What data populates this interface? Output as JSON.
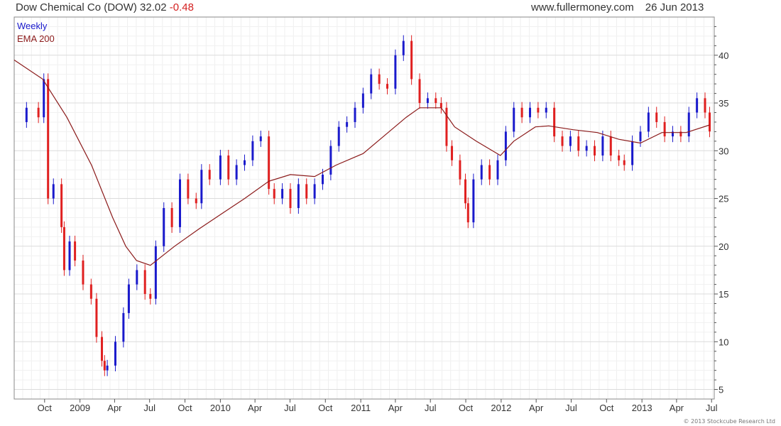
{
  "header": {
    "security": "Dow Chemical Co (DOW)",
    "last": "32.02",
    "change": "-0.48",
    "site": "www.fullermoney.com",
    "date": "26 Jun 2013"
  },
  "footer": {
    "copyright": "© 2013 Stockcube Research Ltd"
  },
  "colors": {
    "up": "#1a1acc",
    "down": "#e02020",
    "ema": "#8b1a1a",
    "grid": "#dcdcdc",
    "axis": "#555555"
  },
  "chart_data": {
    "type": "line",
    "legend": [
      "Weekly",
      "EMA 200"
    ],
    "legend_position": "top-left",
    "grid": true,
    "ylim": [
      4,
      44
    ],
    "y_ticks": [
      5,
      10,
      15,
      20,
      25,
      30,
      35,
      40
    ],
    "x_range": [
      "2008-07-14",
      "2013-07-08"
    ],
    "x_ticks": [
      {
        "label": "Oct",
        "date": "2008-10-01"
      },
      {
        "label": "2009",
        "date": "2009-01-01"
      },
      {
        "label": "Apr",
        "date": "2009-04-01"
      },
      {
        "label": "Jul",
        "date": "2009-07-01"
      },
      {
        "label": "Oct",
        "date": "2009-10-01"
      },
      {
        "label": "2010",
        "date": "2010-01-01"
      },
      {
        "label": "Apr",
        "date": "2010-04-01"
      },
      {
        "label": "Jul",
        "date": "2010-07-01"
      },
      {
        "label": "Oct",
        "date": "2010-10-01"
      },
      {
        "label": "2011",
        "date": "2011-01-01"
      },
      {
        "label": "Apr",
        "date": "2011-04-01"
      },
      {
        "label": "Jul",
        "date": "2011-07-01"
      },
      {
        "label": "Oct",
        "date": "2011-10-01"
      },
      {
        "label": "2012",
        "date": "2012-01-01"
      },
      {
        "label": "Apr",
        "date": "2012-04-01"
      },
      {
        "label": "Jul",
        "date": "2012-07-01"
      },
      {
        "label": "Oct",
        "date": "2012-10-01"
      },
      {
        "label": "2013",
        "date": "2013-01-01"
      },
      {
        "label": "Apr",
        "date": "2013-04-01"
      },
      {
        "label": "Jul",
        "date": "2013-07-01"
      }
    ],
    "series": [
      {
        "name": "Weekly",
        "points": [
          [
            "2008-07-14",
            33.0
          ],
          [
            "2008-08-15",
            34.5
          ],
          [
            "2008-09-15",
            33.5
          ],
          [
            "2008-09-29",
            37.5
          ],
          [
            "2008-10-10",
            25.0
          ],
          [
            "2008-10-24",
            26.5
          ],
          [
            "2008-11-14",
            22.0
          ],
          [
            "2008-11-21",
            17.5
          ],
          [
            "2008-12-05",
            20.5
          ],
          [
            "2008-12-19",
            18.5
          ],
          [
            "2009-01-09",
            16.0
          ],
          [
            "2009-01-30",
            14.5
          ],
          [
            "2009-02-13",
            10.5
          ],
          [
            "2009-02-27",
            8.0
          ],
          [
            "2009-03-06",
            7.0
          ],
          [
            "2009-03-13",
            7.5
          ],
          [
            "2009-04-03",
            10.0
          ],
          [
            "2009-04-24",
            13.0
          ],
          [
            "2009-05-08",
            16.0
          ],
          [
            "2009-05-29",
            17.5
          ],
          [
            "2009-06-19",
            15.0
          ],
          [
            "2009-07-03",
            14.5
          ],
          [
            "2009-07-17",
            20.0
          ],
          [
            "2009-08-07",
            24.0
          ],
          [
            "2009-08-28",
            22.0
          ],
          [
            "2009-09-18",
            27.0
          ],
          [
            "2009-10-09",
            25.0
          ],
          [
            "2009-10-30",
            24.5
          ],
          [
            "2009-11-13",
            28.0
          ],
          [
            "2009-12-04",
            27.0
          ],
          [
            "2010-01-01",
            29.5
          ],
          [
            "2010-01-22",
            27.0
          ],
          [
            "2010-02-12",
            28.5
          ],
          [
            "2010-03-05",
            29.0
          ],
          [
            "2010-03-26",
            31.0
          ],
          [
            "2010-04-16",
            31.5
          ],
          [
            "2010-05-07",
            26.0
          ],
          [
            "2010-05-21",
            25.0
          ],
          [
            "2010-06-11",
            26.0
          ],
          [
            "2010-07-02",
            24.0
          ],
          [
            "2010-07-23",
            26.5
          ],
          [
            "2010-08-13",
            25.0
          ],
          [
            "2010-09-03",
            26.5
          ],
          [
            "2010-09-24",
            27.5
          ],
          [
            "2010-10-15",
            30.5
          ],
          [
            "2010-11-05",
            32.5
          ],
          [
            "2010-11-26",
            33.0
          ],
          [
            "2010-12-17",
            34.5
          ],
          [
            "2011-01-07",
            36.0
          ],
          [
            "2011-01-28",
            38.0
          ],
          [
            "2011-02-18",
            37.0
          ],
          [
            "2011-03-11",
            36.5
          ],
          [
            "2011-04-01",
            40.0
          ],
          [
            "2011-04-22",
            41.5
          ],
          [
            "2011-05-13",
            37.5
          ],
          [
            "2011-06-03",
            35.0
          ],
          [
            "2011-06-24",
            35.5
          ],
          [
            "2011-07-15",
            35.0
          ],
          [
            "2011-07-29",
            34.5
          ],
          [
            "2011-08-12",
            30.5
          ],
          [
            "2011-08-26",
            29.0
          ],
          [
            "2011-09-16",
            27.0
          ],
          [
            "2011-09-30",
            24.5
          ],
          [
            "2011-10-07",
            22.5
          ],
          [
            "2011-10-21",
            27.0
          ],
          [
            "2011-11-11",
            28.5
          ],
          [
            "2011-12-02",
            27.0
          ],
          [
            "2011-12-23",
            29.0
          ],
          [
            "2012-01-13",
            32.0
          ],
          [
            "2012-02-03",
            34.5
          ],
          [
            "2012-02-24",
            33.5
          ],
          [
            "2012-03-16",
            34.5
          ],
          [
            "2012-04-06",
            34.0
          ],
          [
            "2012-04-27",
            34.5
          ],
          [
            "2012-05-18",
            31.5
          ],
          [
            "2012-06-08",
            30.5
          ],
          [
            "2012-06-29",
            31.5
          ],
          [
            "2012-07-20",
            30.0
          ],
          [
            "2012-08-10",
            30.5
          ],
          [
            "2012-08-31",
            29.5
          ],
          [
            "2012-09-21",
            31.5
          ],
          [
            "2012-10-12",
            29.5
          ],
          [
            "2012-11-02",
            29.0
          ],
          [
            "2012-11-16",
            28.5
          ],
          [
            "2012-12-07",
            31.0
          ],
          [
            "2012-12-28",
            32.0
          ],
          [
            "2013-01-18",
            34.0
          ],
          [
            "2013-02-08",
            33.0
          ],
          [
            "2013-03-01",
            31.5
          ],
          [
            "2013-03-22",
            32.0
          ],
          [
            "2013-04-12",
            31.5
          ],
          [
            "2013-05-03",
            34.0
          ],
          [
            "2013-05-24",
            35.5
          ],
          [
            "2013-06-14",
            34.0
          ],
          [
            "2013-06-26",
            32.02
          ]
        ]
      },
      {
        "name": "EMA 200",
        "points": [
          [
            "2008-07-14",
            39.5
          ],
          [
            "2008-09-26",
            37.5
          ],
          [
            "2008-11-28",
            33.5
          ],
          [
            "2009-01-31",
            28.5
          ],
          [
            "2009-03-27",
            23.0
          ],
          [
            "2009-04-30",
            20.0
          ],
          [
            "2009-05-28",
            18.5
          ],
          [
            "2009-07-03",
            18.0
          ],
          [
            "2009-09-04",
            20.0
          ],
          [
            "2009-11-06",
            21.8
          ],
          [
            "2010-01-08",
            23.5
          ],
          [
            "2010-03-05",
            25.0
          ],
          [
            "2010-05-07",
            26.8
          ],
          [
            "2010-07-02",
            27.5
          ],
          [
            "2010-09-03",
            27.3
          ],
          [
            "2010-10-29",
            28.5
          ],
          [
            "2011-01-07",
            29.7
          ],
          [
            "2011-03-04",
            31.6
          ],
          [
            "2011-04-29",
            33.5
          ],
          [
            "2011-06-03",
            34.5
          ],
          [
            "2011-07-29",
            34.5
          ],
          [
            "2011-09-02",
            32.5
          ],
          [
            "2011-10-28",
            31.0
          ],
          [
            "2011-12-30",
            29.5
          ],
          [
            "2012-02-03",
            31.0
          ],
          [
            "2012-03-30",
            32.5
          ],
          [
            "2012-05-04",
            32.6
          ],
          [
            "2012-07-06",
            32.2
          ],
          [
            "2012-09-07",
            31.9
          ],
          [
            "2012-11-02",
            31.2
          ],
          [
            "2012-12-28",
            30.8
          ],
          [
            "2013-02-22",
            31.9
          ],
          [
            "2013-04-26",
            31.9
          ],
          [
            "2013-06-26",
            32.7
          ]
        ]
      }
    ]
  }
}
